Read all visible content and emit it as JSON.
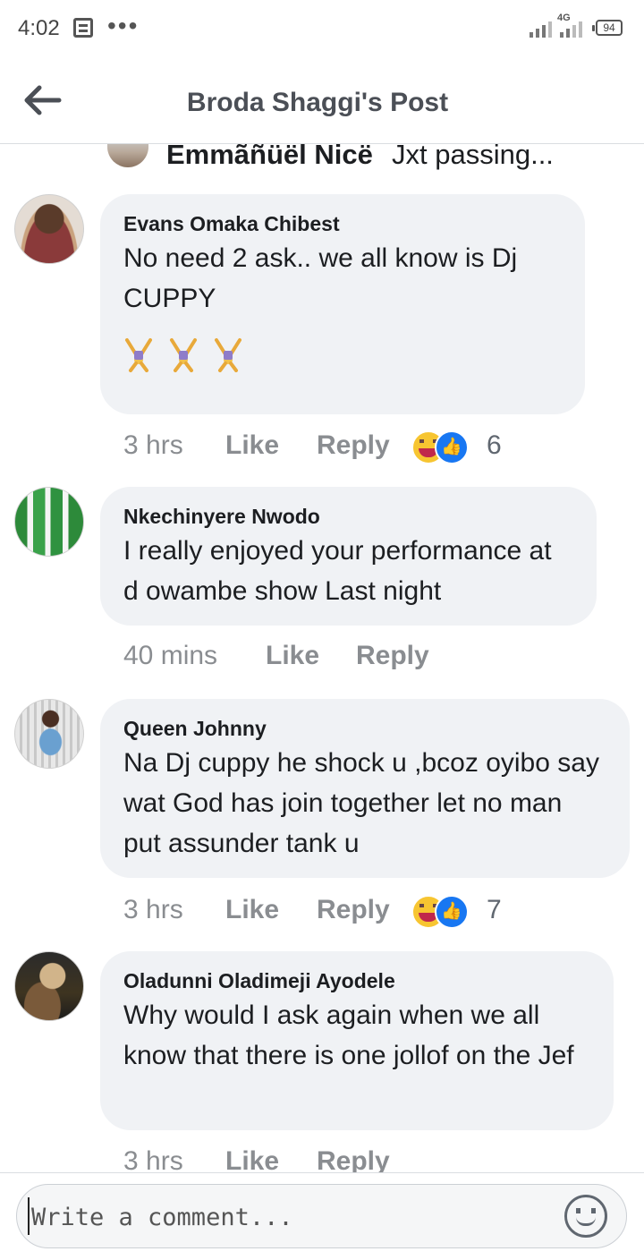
{
  "status": {
    "time": "4:02",
    "network": "4G",
    "battery": "94"
  },
  "header": {
    "title": "Broda Shaggi's Post"
  },
  "partial_reply": {
    "author": "Emmãñüël Nicë",
    "text": "Jxt passing..."
  },
  "comments": [
    {
      "author": "Evans Omaka Chibest",
      "text": "No need 2 ask.. we all know is Dj CUPPY",
      "emoji": "🤸🤸🤸",
      "time": "3 hrs",
      "like": "Like",
      "reply": "Reply",
      "reaction_count": "6",
      "reactions": [
        "haha",
        "like"
      ]
    },
    {
      "author": "Nkechinyere Nwodo",
      "text": "I really enjoyed your performance at d owambe show Last night",
      "time": "40 mins",
      "like": "Like",
      "reply": "Reply"
    },
    {
      "author": "Queen Johnny",
      "text": "Na Dj cuppy he shock u ,bcoz oyibo say wat God has join together let no man put assunder tank u",
      "time": "3 hrs",
      "like": "Like",
      "reply": "Reply",
      "reaction_count": "7",
      "reactions": [
        "haha",
        "like"
      ]
    },
    {
      "author": "Oladunni Oladimeji Ayodele",
      "text": "Why would I ask again when we all know that there is one jollof on the Jef",
      "time": "3 hrs",
      "like": "Like",
      "reply": "Reply"
    }
  ],
  "composer": {
    "placeholder": "Write a comment..."
  },
  "colors": {
    "bubble": "#f0f2f5",
    "muted": "#8a8d91",
    "like_blue": "#1877f2",
    "haha_yellow": "#f7c531"
  }
}
